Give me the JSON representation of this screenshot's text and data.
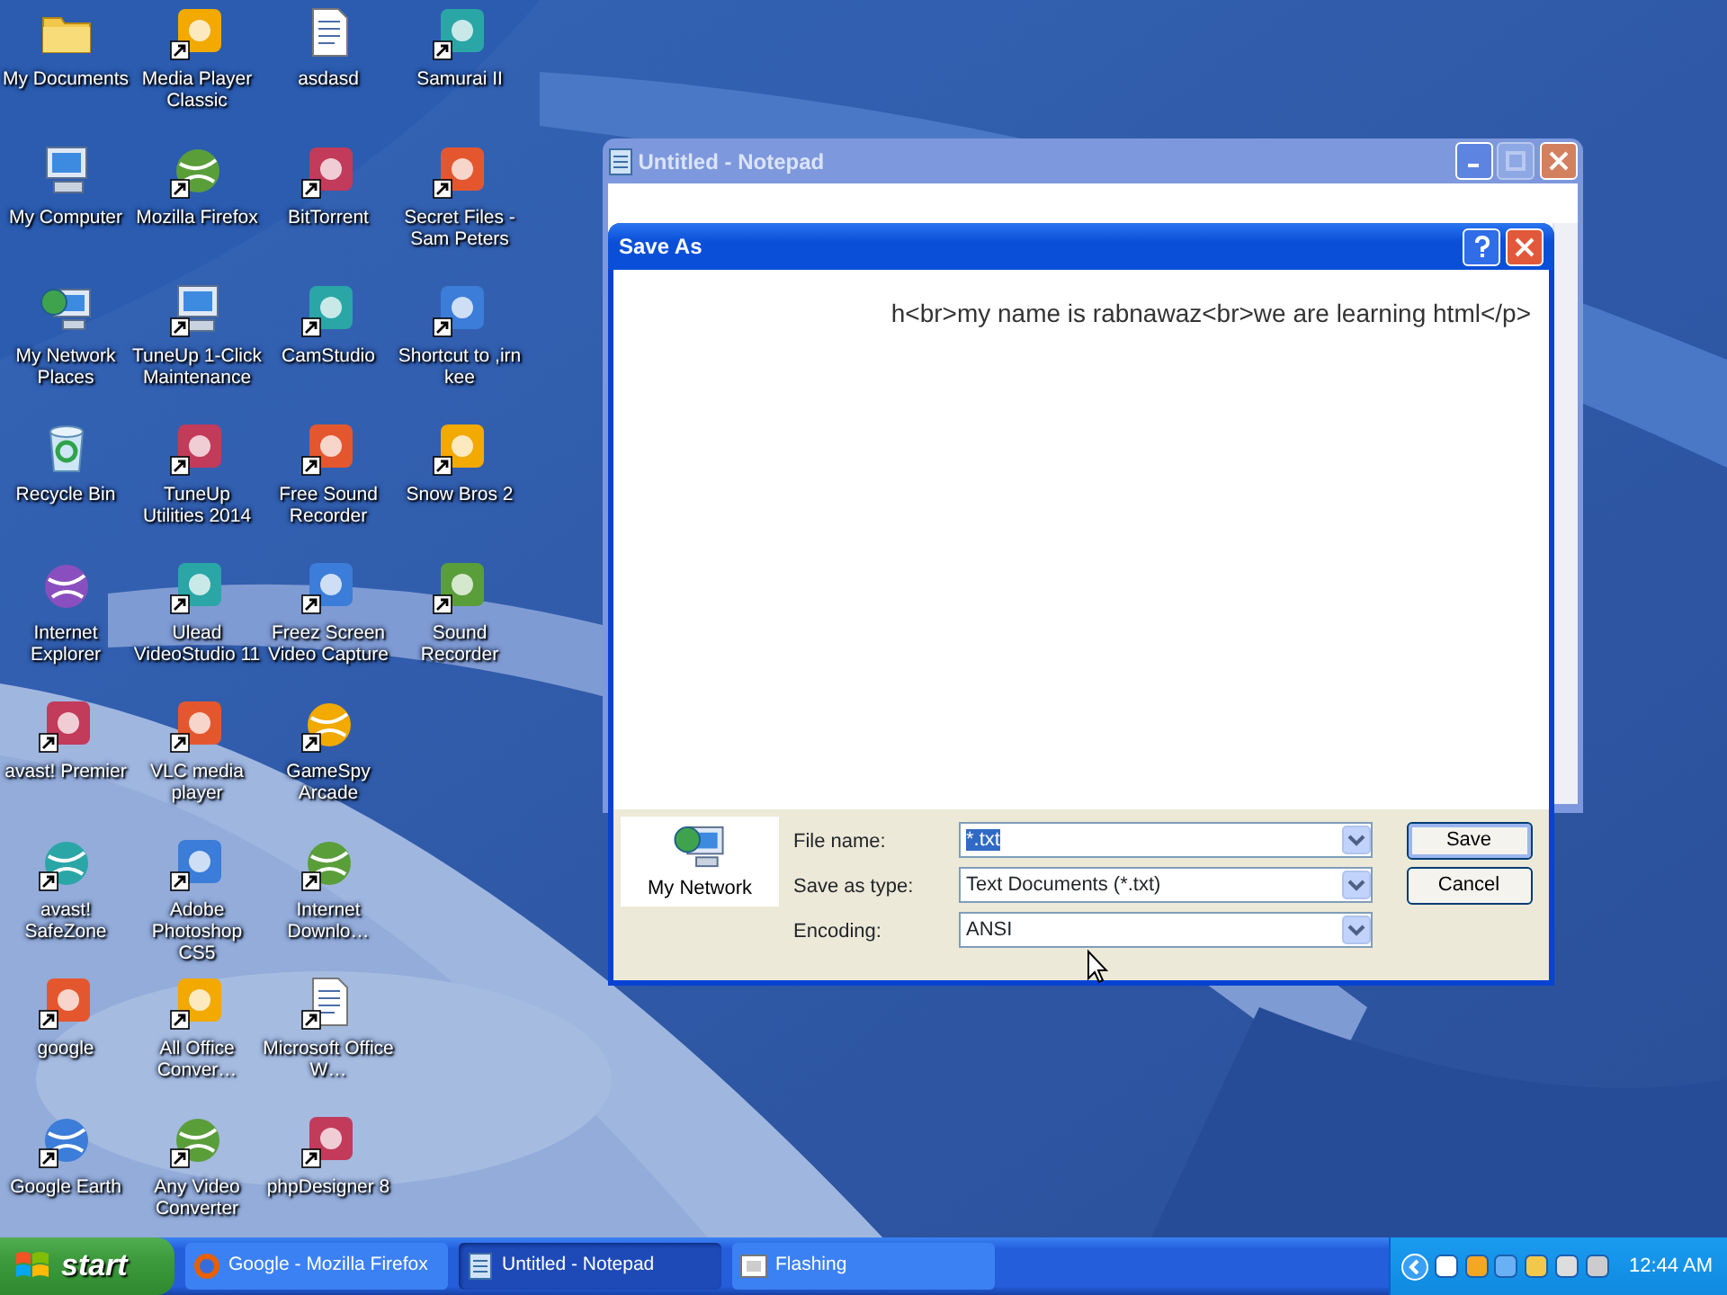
{
  "desktop": {
    "icons": [
      {
        "label": "My Documents",
        "kind": "folder",
        "shortcut": false
      },
      {
        "label": "My Computer",
        "kind": "computer",
        "shortcut": false
      },
      {
        "label": "My Network Places",
        "kind": "network",
        "shortcut": false
      },
      {
        "label": "Recycle Bin",
        "kind": "recycle",
        "shortcut": false
      },
      {
        "label": "Internet Explorer",
        "kind": "globe",
        "shortcut": false
      },
      {
        "label": "avast! Premier",
        "kind": "app",
        "shortcut": true
      },
      {
        "label": "avast! SafeZone",
        "kind": "globe",
        "shortcut": true
      },
      {
        "label": "google",
        "kind": "app",
        "shortcut": true
      },
      {
        "label": "Google Earth",
        "kind": "globe",
        "shortcut": true
      },
      {
        "label": "Media Player Classic",
        "kind": "app",
        "shortcut": true
      },
      {
        "label": "Mozilla Firefox",
        "kind": "globe",
        "shortcut": true
      },
      {
        "label": "TuneUp 1-Click Maintenance",
        "kind": "computer",
        "shortcut": true
      },
      {
        "label": "TuneUp Utilities 2014",
        "kind": "app",
        "shortcut": true
      },
      {
        "label": "Ulead VideoStudio 11",
        "kind": "app",
        "shortcut": true
      },
      {
        "label": "VLC media player",
        "kind": "app",
        "shortcut": true
      },
      {
        "label": "Adobe Photoshop CS5",
        "kind": "app",
        "shortcut": true
      },
      {
        "label": "All Office Conver…",
        "kind": "app",
        "shortcut": true
      },
      {
        "label": "Any Video Converter",
        "kind": "globe",
        "shortcut": true
      },
      {
        "label": "asdasd",
        "kind": "document",
        "shortcut": false
      },
      {
        "label": "BitTorrent",
        "kind": "app",
        "shortcut": true
      },
      {
        "label": "CamStudio",
        "kind": "app",
        "shortcut": true
      },
      {
        "label": "Free Sound Recorder",
        "kind": "app",
        "shortcut": true
      },
      {
        "label": "Freez Screen Video Capture",
        "kind": "app",
        "shortcut": true
      },
      {
        "label": "GameSpy Arcade",
        "kind": "globe",
        "shortcut": true
      },
      {
        "label": "Internet Downlo…",
        "kind": "globe",
        "shortcut": true
      },
      {
        "label": "Microsoft Office W…",
        "kind": "document",
        "shortcut": true
      },
      {
        "label": "phpDesigner 8",
        "kind": "app",
        "shortcut": true
      },
      {
        "label": "Samurai II",
        "kind": "app",
        "shortcut": true
      },
      {
        "label": "Secret Files - Sam Peters",
        "kind": "app",
        "shortcut": true
      },
      {
        "label": "Shortcut to ,irn kee",
        "kind": "app",
        "shortcut": true
      },
      {
        "label": "Snow Bros 2",
        "kind": "app",
        "shortcut": true
      },
      {
        "label": "Sound Recorder",
        "kind": "app",
        "shortcut": true
      }
    ]
  },
  "notepad": {
    "title": "Untitled - Notepad"
  },
  "save_as": {
    "title": "Save As",
    "preview_text": "h<br>my name is rabnawaz<br>we are learning html</p>",
    "places": [
      {
        "label": "My Network"
      }
    ],
    "fields": [
      {
        "label": "File name:",
        "value": "*.txt",
        "selected": true
      },
      {
        "label": "Save as type:",
        "value": "Text Documents (*.txt)",
        "selected": false
      },
      {
        "label": "Encoding:",
        "value": "ANSI",
        "selected": false
      }
    ],
    "buttons": [
      {
        "label": "Save",
        "default": true
      },
      {
        "label": "Cancel",
        "default": false
      }
    ]
  },
  "taskbar": {
    "start": "start",
    "tasks": [
      {
        "label": "Google - Mozilla Firefox",
        "kind": "browser",
        "selected": false
      },
      {
        "label": "Untitled - Notepad",
        "kind": "notepad",
        "selected": true
      },
      {
        "label": "Flashing",
        "kind": "app",
        "selected": false
      }
    ],
    "clock": "12:44 AM"
  }
}
